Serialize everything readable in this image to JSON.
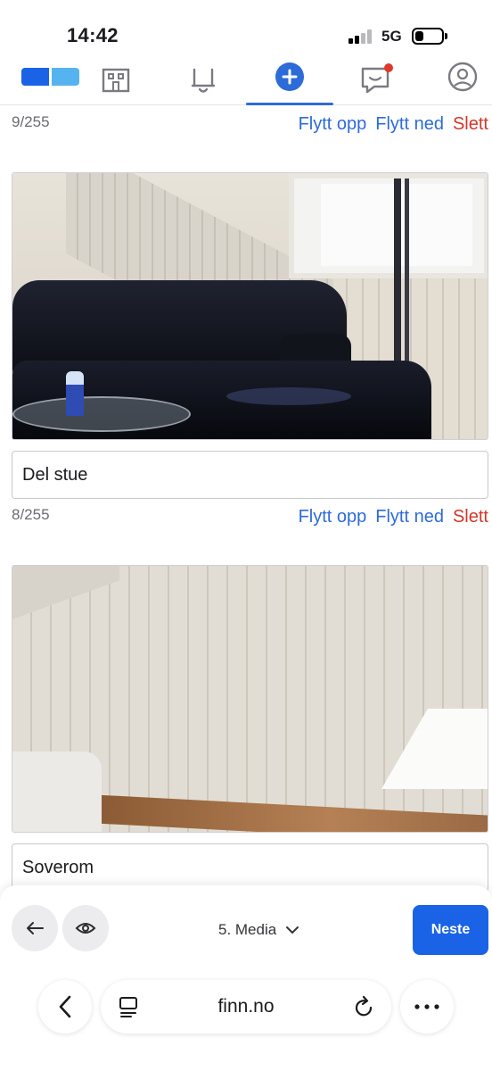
{
  "status_bar": {
    "time": "14:42",
    "network": "5G"
  },
  "top_nav": {
    "items": [
      {
        "icon": "finn-logo"
      },
      {
        "icon": "building-icon"
      },
      {
        "icon": "bell-icon"
      },
      {
        "icon": "plus-circle-icon",
        "active": true
      },
      {
        "icon": "chat-icon",
        "has_notification": true
      },
      {
        "icon": "profile-icon"
      }
    ],
    "accent": "#2d6bd9",
    "notification_color": "#e0382b"
  },
  "images": [
    {
      "counter": "9/255",
      "actions": {
        "up": "Flytt opp",
        "down": "Flytt ned",
        "delete": "Slett"
      }
    },
    {
      "photo": "living-room-sofa",
      "caption": "Del stue",
      "counter": "8/255",
      "actions": {
        "up": "Flytt opp",
        "down": "Flytt ned",
        "delete": "Slett"
      }
    },
    {
      "photo": "bedroom-wall",
      "caption": "Soverom"
    }
  ],
  "bottom_bar": {
    "back_icon": "arrow-left-icon",
    "preview_icon": "eye-icon",
    "step_label": "5. Media",
    "next_label": "Neste",
    "next_color": "#1a63e6"
  },
  "browser": {
    "url": "finn.no",
    "back_icon": "chevron-left-icon",
    "tabs_icon": "tabs-icon",
    "reload_icon": "reload-icon",
    "more_icon": "more-icon"
  },
  "colors": {
    "link": "#2d6bd9",
    "danger": "#d1372a",
    "muted": "#6b6b73"
  }
}
